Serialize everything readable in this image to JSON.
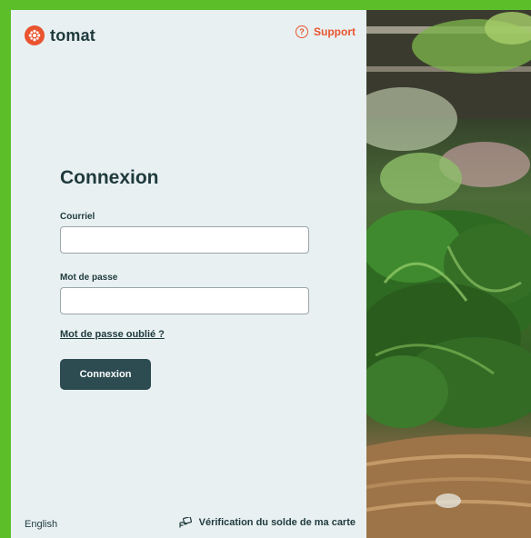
{
  "brand": {
    "name": "tomat",
    "color": "#e9542f",
    "icon": "tomato-logo-icon"
  },
  "header": {
    "support_label": "Support",
    "support_icon": "help-circle-icon"
  },
  "form": {
    "title": "Connexion",
    "email_label": "Courriel",
    "email_value": "",
    "password_label": "Mot de passe",
    "password_value": "",
    "forgot_link": "Mot de passe oublié ?",
    "submit_label": "Connexion"
  },
  "footer": {
    "language": "English",
    "balance_label": "Vérification du solde de ma carte",
    "balance_icon": "hand-card-icon"
  },
  "colors": {
    "accent": "#e9542f",
    "primary_button": "#2d4c52",
    "panel_bg": "#e8f0f2",
    "text": "#1f3a3d"
  },
  "photo": {
    "subject": "fresh-produce-image"
  }
}
